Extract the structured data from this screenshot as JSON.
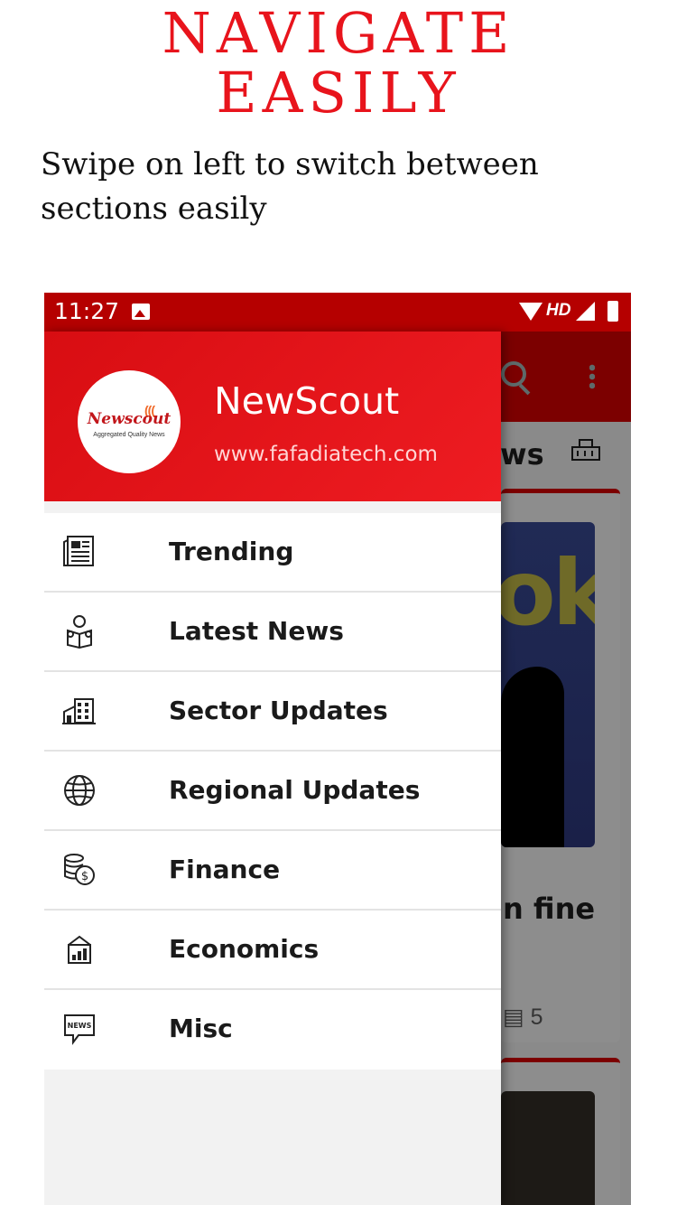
{
  "promo": {
    "headline_line1": "NAVIGATE",
    "headline_line2": "EASILY",
    "subtitle": "Swipe on left to switch between sections easily",
    "accent_color": "#e8141c"
  },
  "status_bar": {
    "time": "11:27",
    "network": "HD",
    "icons": [
      "image-icon",
      "wifi-icon",
      "signal-icon",
      "battery-icon"
    ],
    "color": "#b50000"
  },
  "drawer": {
    "app_name": "NewScout",
    "website": "www.fafadiatech.com",
    "logo_text": "Newscout",
    "logo_tagline": "Aggregated Quality News",
    "header_color": "#e8141c",
    "items": [
      {
        "label": "Trending",
        "icon": "newspaper-icon"
      },
      {
        "label": "Latest News",
        "icon": "reader-icon"
      },
      {
        "label": "Sector Updates",
        "icon": "factory-icon"
      },
      {
        "label": "Regional Updates",
        "icon": "globe-icon"
      },
      {
        "label": "Finance",
        "icon": "coins-icon"
      },
      {
        "label": "Economics",
        "icon": "chart-house-icon"
      },
      {
        "label": "Misc",
        "icon": "news-bubble-icon"
      }
    ]
  },
  "background_app": {
    "tab_fragment": "ws",
    "card_headline_fragment": "n fine",
    "image_text": "ok",
    "card_count": "5"
  }
}
